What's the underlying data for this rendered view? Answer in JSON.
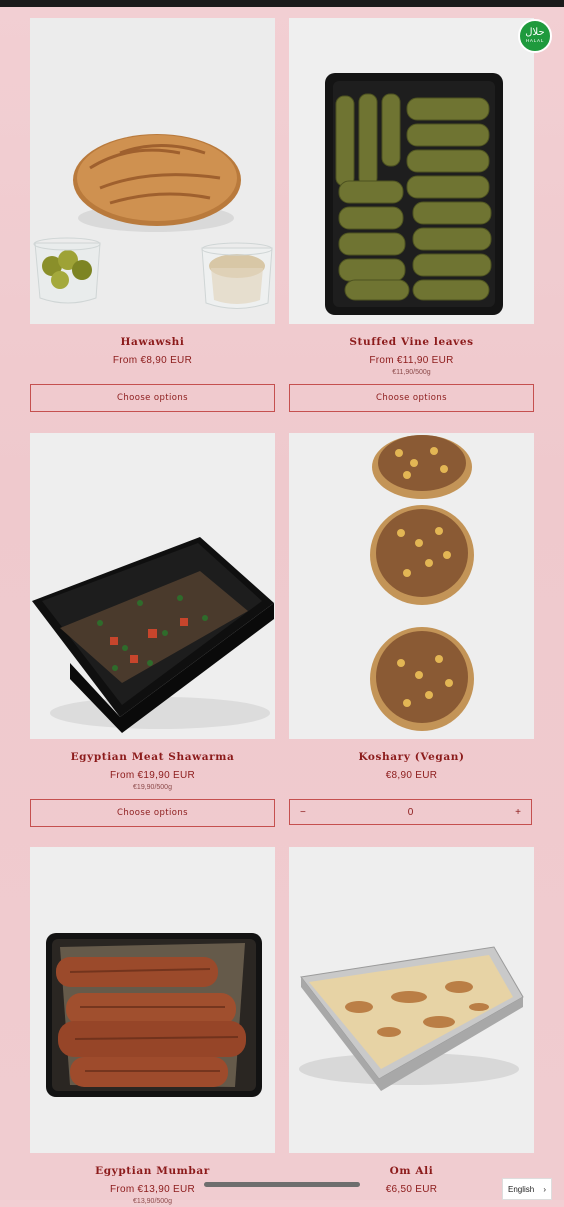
{
  "products": [
    {
      "name": "Hawawshi",
      "price": "From €8,90 EUR",
      "unit": "",
      "action": "Choose options"
    },
    {
      "name": "Stuffed Vine leaves",
      "price": "From €11,90 EUR",
      "unit": "€11,90/500g",
      "action": "Choose options"
    },
    {
      "name": "Egyptian Meat Shawarma",
      "price": "From €19,90 EUR",
      "unit": "€19,90/500g",
      "action": "Choose options"
    },
    {
      "name": "Koshary (Vegan)",
      "price": "€8,90 EUR",
      "unit": "",
      "quantity": {
        "minus": "−",
        "value": "0",
        "plus": "+"
      }
    },
    {
      "name": "Egyptian Mumbar",
      "price": "From €13,90 EUR",
      "unit": "€13,90/500g"
    },
    {
      "name": "Om Ali",
      "price": "€6,50 EUR",
      "unit": ""
    }
  ],
  "badge": {
    "arabic": "حلال",
    "latin": "HALAL"
  },
  "language": {
    "label": "English",
    "chevron": "›"
  },
  "colors": {
    "accent": "#8c1b1b",
    "border": "#c5504f",
    "background": "#f0ccd0",
    "halal": "#1f9a3d"
  }
}
